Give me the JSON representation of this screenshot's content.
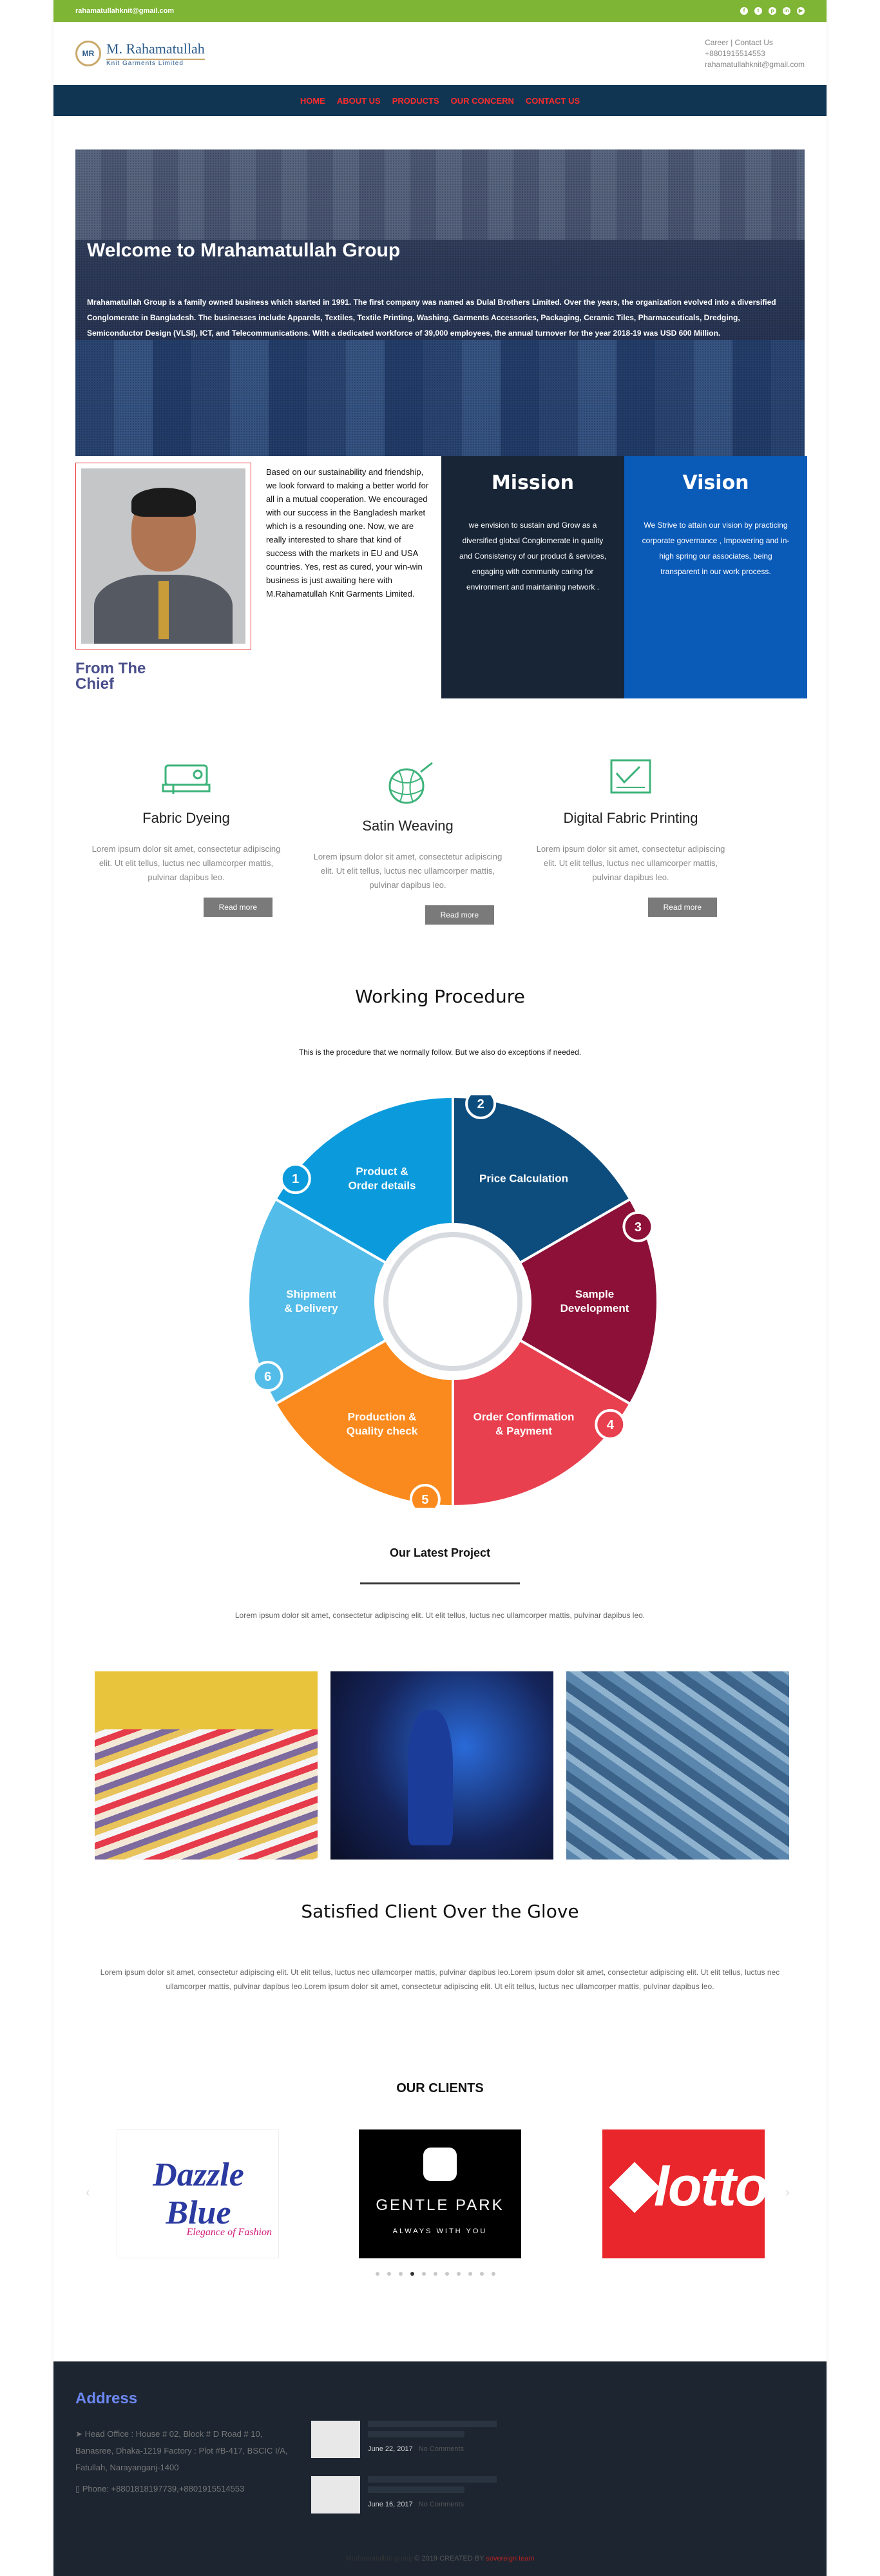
{
  "topbar": {
    "email": "rahamatullahknit@gmail.com",
    "social_icons": [
      "facebook-icon",
      "twitter-icon",
      "pinterest-icon",
      "linkedin-icon",
      "youtube-icon"
    ]
  },
  "header": {
    "logo_name": "M. Rahamatullah",
    "logo_sub": "Knit Garments Limited",
    "logo_mark": "MR",
    "links": "Career | Contact Us",
    "phone": "+8801915514553",
    "email": "rahamatullahknit@gmail.com"
  },
  "nav": [
    "HOME",
    "ABOUT US",
    "PRODUCTS",
    "OUR CONCERN",
    "CONTACT US"
  ],
  "hero": {
    "title": "Welcome to Mrahamatullah Group",
    "text": "Mrahamatullah Group is a family owned business which started in 1991. The first company was named as Dulal Brothers Limited. Over the years, the organization evolved into a diversified Conglomerate in Bangladesh. The businesses include Apparels, Textiles, Textile Printing, Washing, Garments Accessories, Packaging, Ceramic Tiles, Pharmaceuticals, Dredging, Semiconductor Design (VLSI), ICT, and Telecommunications. With a dedicated workforce of 39,000 employees, the annual turnover for the year 2018-19 was USD 600 Million."
  },
  "chief": {
    "text": "Based on our sustainability and friendship, we look forward to making a better world for all in a mutual cooperation. We encouraged with our success in the Bangladesh market which is a resounding one. Now, we are really interested to share that kind of success with the markets in EU and USA countries. Yes, rest as cured, your win-win business is just awaiting here with M.Rahamatullah Knit Garments Limited.",
    "title_line1": "From The",
    "title_line2": "Chief"
  },
  "mission": {
    "title": "Mission",
    "text": "we envision to sustain and Grow as a diversified global Conglomerate in quality and Consistency of our product & services, engaging with community caring for environment and maintaining network ."
  },
  "vision": {
    "title": "Vision",
    "text": "We Strive to attain our vision by practicing corporate governance , Impowering and in-high spring our associates, being transparent in our work process."
  },
  "services": [
    {
      "title": "Fabric Dyeing",
      "text": "Lorem ipsum dolor sit amet, consectetur adipiscing elit. Ut elit tellus, luctus nec ullamcorper mattis, pulvinar dapibus leo.",
      "button": "Read more",
      "icon": "sewing-machine-icon"
    },
    {
      "title": "Satin Weaving",
      "text": "Lorem ipsum dolor sit amet, consectetur adipiscing elit. Ut elit tellus, luctus nec ullamcorper mattis, pulvinar dapibus leo.",
      "button": "Read more",
      "icon": "yarn-ball-icon"
    },
    {
      "title": "Digital Fabric Printing",
      "text": "Lorem ipsum dolor sit amet, consectetur adipiscing elit. Ut elit tellus, luctus nec ullamcorper mattis, pulvinar dapibus leo.",
      "button": "Read more",
      "icon": "fabric-print-icon"
    }
  ],
  "procedure": {
    "title": "Working Procedure",
    "subtitle": "This is the procedure that we normally follow. But we also do exceptions if needed.",
    "steps": [
      {
        "num": "1",
        "label1": "Product &",
        "label2": "Order details",
        "color": "#0b9bdc"
      },
      {
        "num": "2",
        "label1": "Price Calculation",
        "label2": "",
        "color": "#0d4d7e"
      },
      {
        "num": "3",
        "label1": "Sample",
        "label2": "Development",
        "color": "#8c1038"
      },
      {
        "num": "4",
        "label1": "Order Confirmation",
        "label2": "& Payment",
        "color": "#e8404f"
      },
      {
        "num": "5",
        "label1": "Production &",
        "label2": "Quality check",
        "color": "#fa8a1e"
      },
      {
        "num": "6",
        "label1": "Shipment",
        "label2": "& Delivery",
        "color": "#54bce8"
      }
    ]
  },
  "projects": {
    "title": "Our Latest Project",
    "text": "Lorem ipsum dolor sit amet, consectetur adipiscing elit. Ut elit tellus, luctus nec ullamcorper mattis, pulvinar dapibus leo."
  },
  "satisfied": {
    "title": "Satisfied Client Over the Glove",
    "text": "Lorem ipsum dolor sit amet, consectetur adipiscing elit. Ut elit tellus, luctus nec ullamcorper mattis, pulvinar dapibus leo.Lorem ipsum dolor sit amet, consectetur adipiscing elit. Ut elit tellus, luctus nec ullamcorper mattis, pulvinar dapibus leo.Lorem ipsum dolor sit amet, consectetur adipiscing elit. Ut elit tellus, luctus nec ullamcorper mattis, pulvinar dapibus leo."
  },
  "clients": {
    "title": "OUR CLIENTS",
    "logos": [
      {
        "name": "Dazzle Blue",
        "tagline": "Elegance of Fashion"
      },
      {
        "name": "GENTLE PARK",
        "tagline": "ALWAYS WITH YOU"
      },
      {
        "name": "lotto",
        "tagline": ""
      }
    ],
    "dot_count": 11,
    "active_dot": 3
  },
  "footer": {
    "title": "Address",
    "address": "Head Office : House # 02, Block # D Road # 10, Banasree, Dhaka-1219 Factory : Plot #B-417, BSCIC I/A, Fatullah, Narayanganj-1400",
    "phone": "Phone: +8801818197739,+8801915514553",
    "posts": [
      {
        "date": "June 22, 2017",
        "comments": "No Comments"
      },
      {
        "date": "June 16, 2017",
        "comments": "No Comments"
      }
    ],
    "copyright_left": "Mrahamatullah group",
    "copyright_mid": "© 2019 CREATED BY",
    "copyright_right": "sovereign team"
  }
}
